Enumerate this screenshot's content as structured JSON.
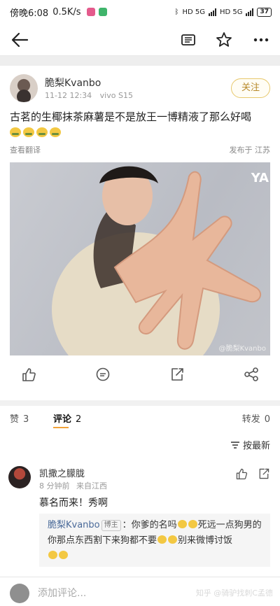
{
  "status": {
    "time": "傍晚6:08",
    "speed": "0.5K/s",
    "network1": "HD 5G",
    "network2": "HD 5G",
    "battery": "37"
  },
  "colors": {
    "accent": "#f2a33a",
    "follow_border": "#e7c76a",
    "follow_text": "#b7892a",
    "link": "#4a6a99"
  },
  "post": {
    "author": "脆梨Kvanbo",
    "date": "11-12 12:34",
    "device": "vivo S15",
    "follow_label": "关注",
    "text": "古茗的生椰抹茶麻薯是不是放王一博精液了那么好喝",
    "translate_label": "查看翻译",
    "location": "发布于 江苏",
    "image_watermark": "@脆梨Kvanbo",
    "image_corner_text": "YA"
  },
  "counts": {
    "likes_label": "赞",
    "likes_count": "3",
    "comments_label": "评论",
    "comments_count": "2",
    "reposts_label": "转发",
    "reposts_count": "0"
  },
  "sort_label": "按最新",
  "comment": {
    "author": "凯撒之朦胧",
    "time": "8 分钟前",
    "location": "来自江西",
    "text": "慕名而来！秀啊",
    "reply": {
      "author": "脆梨Kvanbo",
      "tag": "博主",
      "part1": "：你爹的名吗",
      "part2": "死远一点狗男的 你那点东西割下来狗都不要",
      "part3": "别来微博讨饭"
    }
  },
  "bottom": {
    "placeholder": "添加评论...",
    "watermark": "知乎 @骑驴找刺C孟德"
  }
}
